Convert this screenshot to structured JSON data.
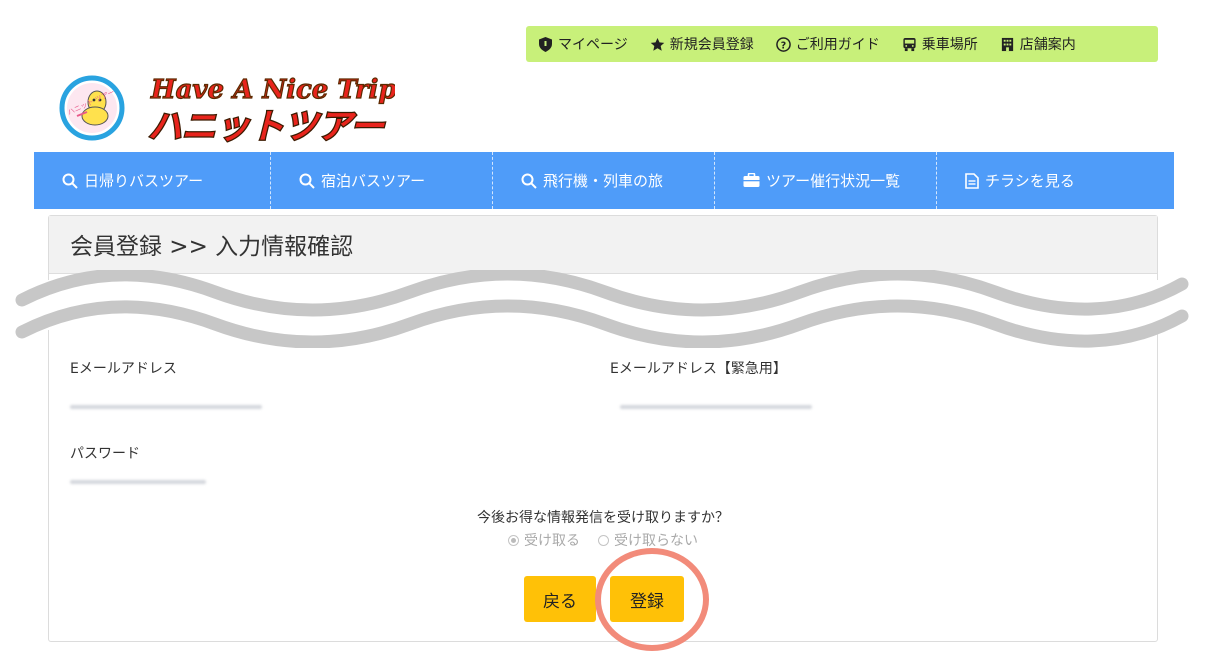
{
  "top_links": [
    {
      "label": "マイページ",
      "icon": "shield-icon"
    },
    {
      "label": "新規会員登録",
      "icon": "star-icon"
    },
    {
      "label": "ご利用ガイド",
      "icon": "question-circle-icon"
    },
    {
      "label": "乗車場所",
      "icon": "bus-icon"
    },
    {
      "label": "店舗案内",
      "icon": "building-icon"
    }
  ],
  "logo": {
    "line1": "Have A Nice Trip",
    "line2": "ハニットツアー",
    "mascot": "ハニット ツアー"
  },
  "nav": [
    {
      "label": "日帰りバスツアー",
      "icon": "search-icon"
    },
    {
      "label": "宿泊バスツアー",
      "icon": "search-icon"
    },
    {
      "label": "飛行機・列車の旅",
      "icon": "search-icon"
    },
    {
      "label": "ツアー催行状況一覧",
      "icon": "briefcase-icon"
    },
    {
      "label": "チラシを見る",
      "icon": "document-icon"
    }
  ],
  "page_title": "会員登録 >> 入力情報確認",
  "fields": {
    "email_label": "Eメールアドレス",
    "email_emergency_label": "Eメールアドレス【緊急用】",
    "password_label": "パスワード"
  },
  "newsletter": {
    "question": "今後お得な情報発信を受け取りますか？",
    "options": [
      "受け取る",
      "受け取らない"
    ],
    "selected": "受け取る"
  },
  "buttons": {
    "back": "戻る",
    "submit": "登録"
  },
  "colors": {
    "nav": "#4f9cf9",
    "top_links": "#c8f07a",
    "button": "#ffc107",
    "highlight": "#f28b7a"
  }
}
